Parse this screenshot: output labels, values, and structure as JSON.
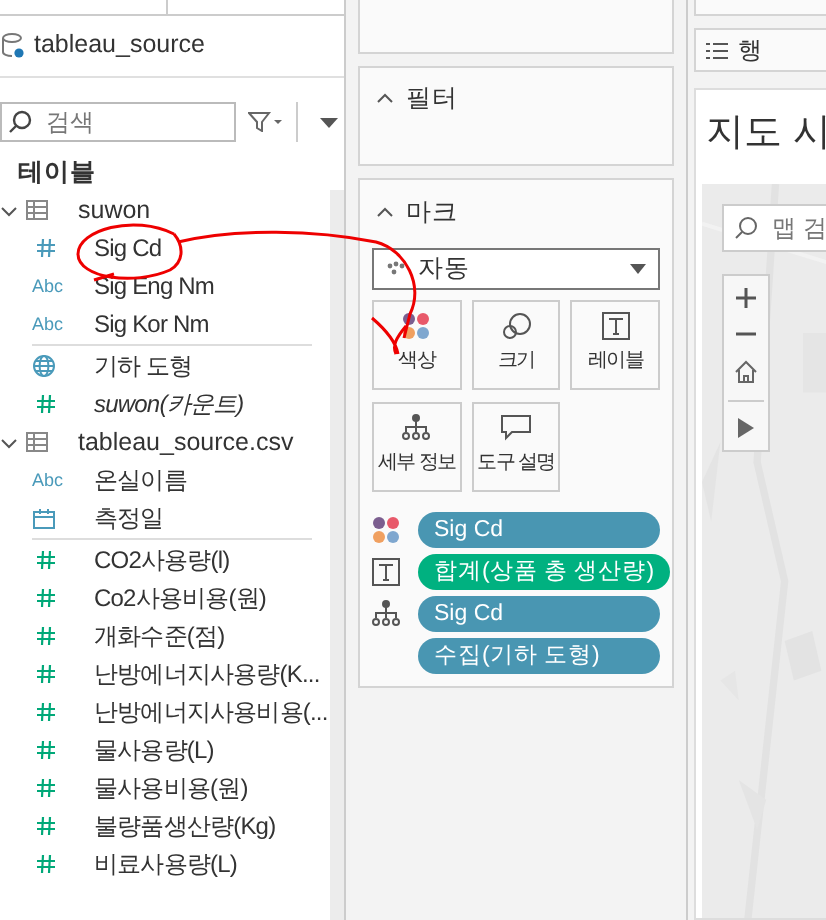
{
  "data_source": {
    "name": "tableau_source"
  },
  "search": {
    "placeholder": "검색"
  },
  "section_title": "테이블",
  "tables": [
    {
      "name": "suwon",
      "expanded": true,
      "groups": [
        [
          {
            "name": "Sig Cd",
            "kind": "number",
            "color": "#4a9aba",
            "italic": false
          },
          {
            "name": "Sig Eng Nm",
            "kind": "string",
            "icon_text": "Abc",
            "color": "#4a9aba",
            "italic": false
          },
          {
            "name": "Sig Kor Nm",
            "kind": "string",
            "icon_text": "Abc",
            "color": "#4a9aba",
            "italic": false
          }
        ],
        [
          {
            "name": "기하 도형",
            "kind": "geo",
            "color": "#4a9aba",
            "italic": false
          },
          {
            "name": "suwon(카운트)",
            "kind": "number",
            "color": "#00a878",
            "italic": true
          }
        ]
      ]
    },
    {
      "name": "tableau_source.csv",
      "expanded": true,
      "groups": [
        [
          {
            "name": "온실이름",
            "kind": "string",
            "icon_text": "Abc",
            "color": "#4a9aba",
            "italic": false
          },
          {
            "name": "측정일",
            "kind": "date",
            "color": "#4a9aba",
            "italic": false
          }
        ],
        [
          {
            "name": "CO2사용량(l)",
            "kind": "number",
            "color": "#00a878",
            "italic": false
          },
          {
            "name": "Co2사용비용(원)",
            "kind": "number",
            "color": "#00a878",
            "italic": false
          },
          {
            "name": "개화수준(점)",
            "kind": "number",
            "color": "#00a878",
            "italic": false
          },
          {
            "name": "난방에너지사용량(K...",
            "kind": "number",
            "color": "#00a878",
            "italic": false
          },
          {
            "name": "난방에너지사용비용(...",
            "kind": "number",
            "color": "#00a878",
            "italic": false
          },
          {
            "name": "물사용량(L)",
            "kind": "number",
            "color": "#00a878",
            "italic": false
          },
          {
            "name": "물사용비용(원)",
            "kind": "number",
            "color": "#00a878",
            "italic": false
          },
          {
            "name": "불량품생산량(Kg)",
            "kind": "number",
            "color": "#00a878",
            "italic": false
          },
          {
            "name": "비료사용량(L)",
            "kind": "number",
            "color": "#00a878",
            "italic": false
          }
        ]
      ]
    }
  ],
  "filters": {
    "title": "필터",
    "expanded": true
  },
  "marks": {
    "title": "마크",
    "expanded": true,
    "mark_type": "자동",
    "buttons": [
      {
        "label": "색상",
        "kind": "color"
      },
      {
        "label": "크기",
        "kind": "size"
      },
      {
        "label": "레이블",
        "kind": "label"
      },
      {
        "label": "세부 정보",
        "kind": "detail"
      },
      {
        "label": "도구 설명",
        "kind": "tooltip"
      }
    ],
    "pills": [
      {
        "label": "Sig Cd",
        "kind": "color",
        "color": "#4996b2"
      },
      {
        "label": "합계(상품 총 생산량)",
        "kind": "label",
        "color": "#00b180"
      },
      {
        "label": "Sig Cd",
        "kind": "detail",
        "color": "#4996b2"
      },
      {
        "label": "수집(기하 도형)",
        "kind": "none",
        "color": "#4996b2"
      }
    ]
  },
  "rows_shelf": {
    "label": "행"
  },
  "sheet": {
    "title": "지도 시",
    "map_search_placeholder": "맵 검"
  }
}
